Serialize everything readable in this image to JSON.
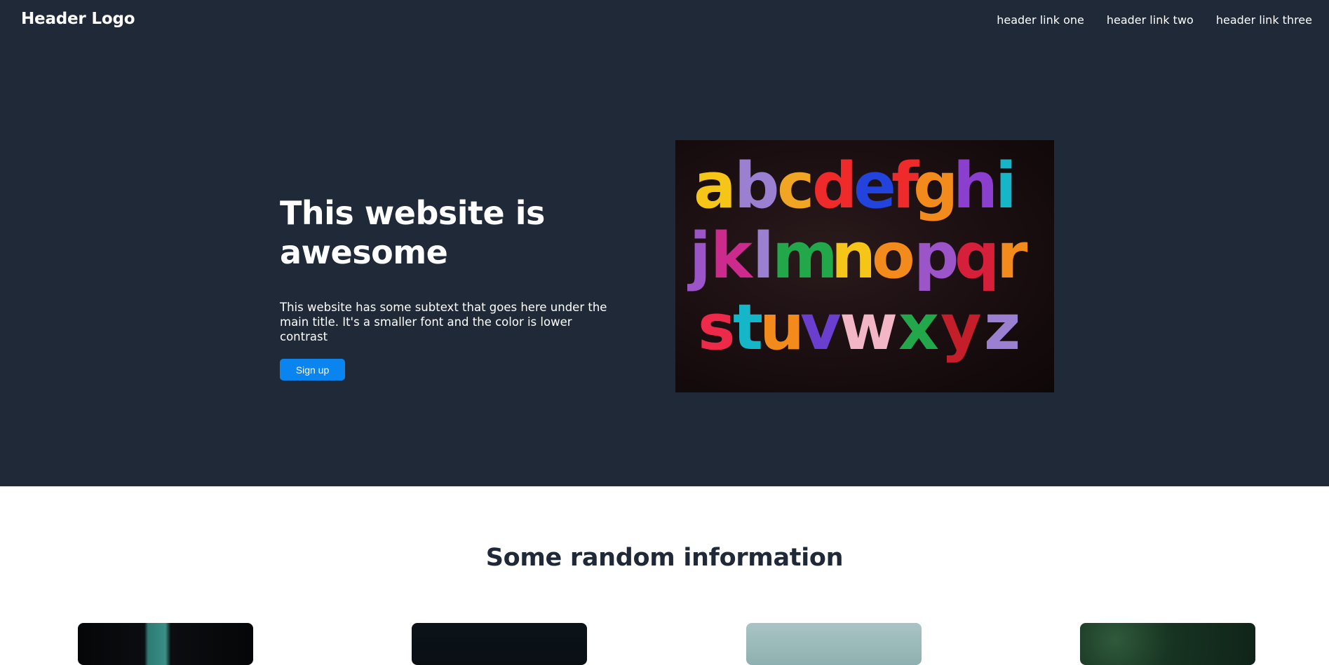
{
  "header": {
    "logo": "Header Logo",
    "links": [
      {
        "label": "header link one"
      },
      {
        "label": "header link two"
      },
      {
        "label": "header link three"
      }
    ]
  },
  "hero": {
    "title": "This website is awesome",
    "subtext": "This website has some subtext that goes here under the main title. It's a smaller font and the color is lower contrast",
    "signup_label": "Sign up",
    "image_letters": {
      "row1": "abcdefghi",
      "row2": "jklmnopqr",
      "row3": "stuvwxyz"
    }
  },
  "info": {
    "title": "Some random information"
  },
  "colors": {
    "dark_bg": "#1f2937",
    "accent": "#0a84ee",
    "text_light": "#ffffff"
  }
}
